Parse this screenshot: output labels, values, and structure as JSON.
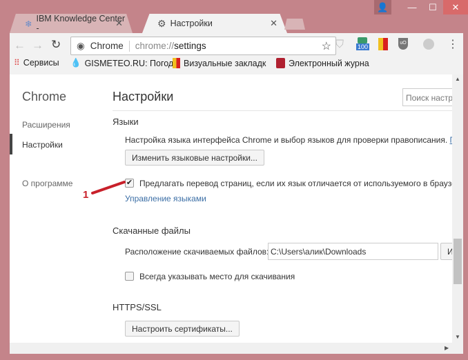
{
  "window": {
    "user_icon": "user-icon",
    "minimize": "—",
    "maximize": "☐",
    "close": "✕"
  },
  "tabs": [
    {
      "title": "IBM Knowledge Center -",
      "icon": "snowflake-icon"
    },
    {
      "title": "Настройки",
      "icon": "gear-icon"
    }
  ],
  "omnibox": {
    "origin": "Chrome",
    "url_prefix": "chrome://",
    "url_path": "settings"
  },
  "extensions": {
    "badge": "100"
  },
  "bookmarks": [
    "Сервисы",
    "GISMETEO.RU: Погод",
    "Визуальные закладк",
    "Электронный журна"
  ],
  "sidebar": {
    "title": "Chrome",
    "items": [
      "Расширения",
      "Настройки",
      "О программе"
    ]
  },
  "main": {
    "title": "Настройки",
    "search_placeholder": "Поиск настр",
    "languages": {
      "heading": "Языки",
      "desc": "Настройка языка интерфейса Chrome и выбор языков для проверки правописания.",
      "desc_link": "П",
      "button": "Изменить языковые настройки...",
      "translate_label": "Предлагать перевод страниц, если их язык отличается от используемого в браузе",
      "translate_checked": true,
      "manage_link": "Управление языками"
    },
    "downloads": {
      "heading": "Скачанные файлы",
      "location_label": "Расположение скачиваемых файлов:",
      "location_value": "C:\\Users\\алик\\Downloads",
      "change_button": "И",
      "ask_label": "Всегда указывать место для скачивания",
      "ask_checked": false
    },
    "https": {
      "heading": "HTTPS/SSL",
      "button": "Настроить сертификаты..."
    }
  },
  "annotation": {
    "label": "1",
    "color": "#c8202a"
  },
  "scroll": {
    "vertical_position_fraction": 0.62
  }
}
